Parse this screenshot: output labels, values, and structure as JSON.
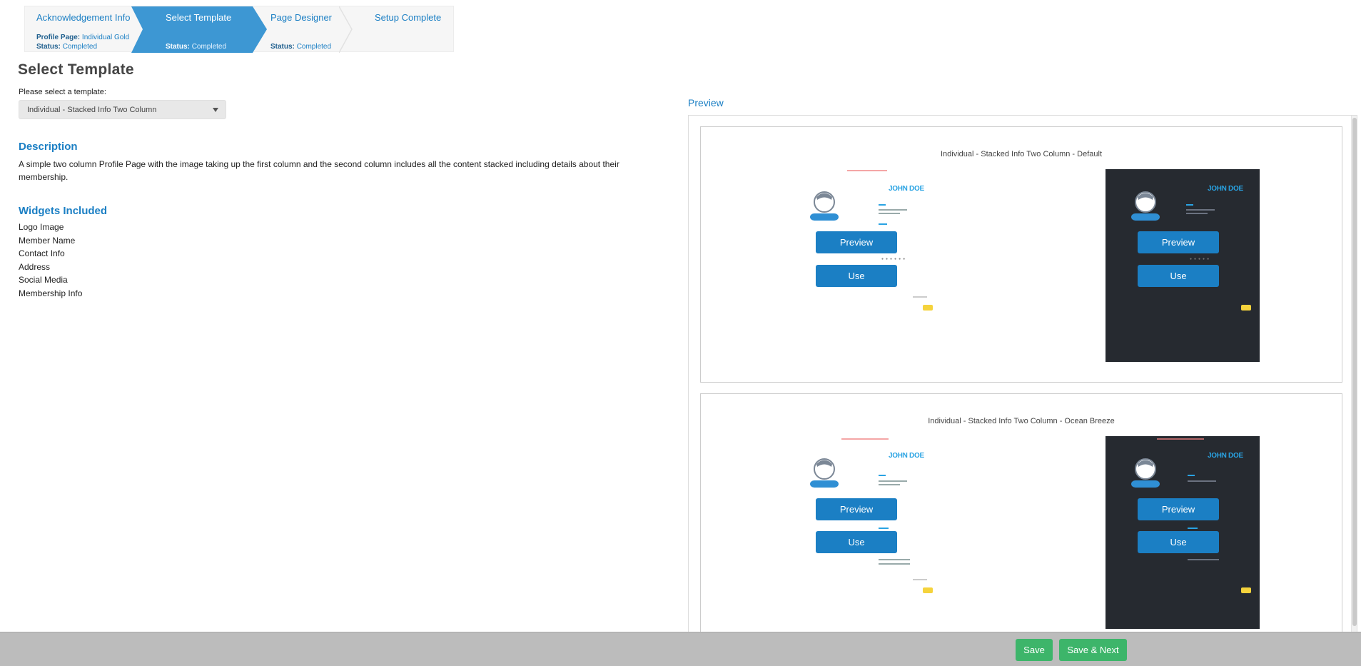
{
  "wizard": {
    "steps": [
      {
        "title": "Acknowledgement Info",
        "meta1_label": "Profile Page:",
        "meta1_value": "Individual Gold",
        "meta2_label": "Status:",
        "meta2_value": "Completed"
      },
      {
        "title": "Select Template",
        "meta_label": "Status:",
        "meta_value": "Completed"
      },
      {
        "title": "Page Designer",
        "meta_label": "Status:",
        "meta_value": "Completed"
      },
      {
        "title": "Setup Complete"
      }
    ]
  },
  "page_title": "Select Template",
  "template_select": {
    "label": "Please select a template:",
    "value": "Individual - Stacked Info Two Column"
  },
  "description": {
    "heading": "Description",
    "text": "A simple two column Profile Page with the image taking up the first column and the second column includes all the content stacked including details about their membership."
  },
  "widgets": {
    "heading": "Widgets Included",
    "items": [
      "Logo Image",
      "Member Name",
      "Contact Info",
      "Address",
      "Social Media",
      "Membership Info"
    ]
  },
  "preview": {
    "heading": "Preview",
    "cards": [
      {
        "title": "Individual - Stacked Info Two Column - Default",
        "name": "JOHN DOE",
        "preview_label": "Preview",
        "use_label": "Use"
      },
      {
        "title": "Individual - Stacked Info Two Column - Ocean Breeze",
        "name": "JOHN DOE",
        "preview_label": "Preview",
        "use_label": "Use"
      }
    ]
  },
  "footer": {
    "save_label": "Save",
    "save_next_label": "Save & Next"
  },
  "colors": {
    "accent": "#1b7fc4",
    "step_active": "#3d97d3",
    "save_green": "#3db56a",
    "dark_theme": "#262a30"
  }
}
